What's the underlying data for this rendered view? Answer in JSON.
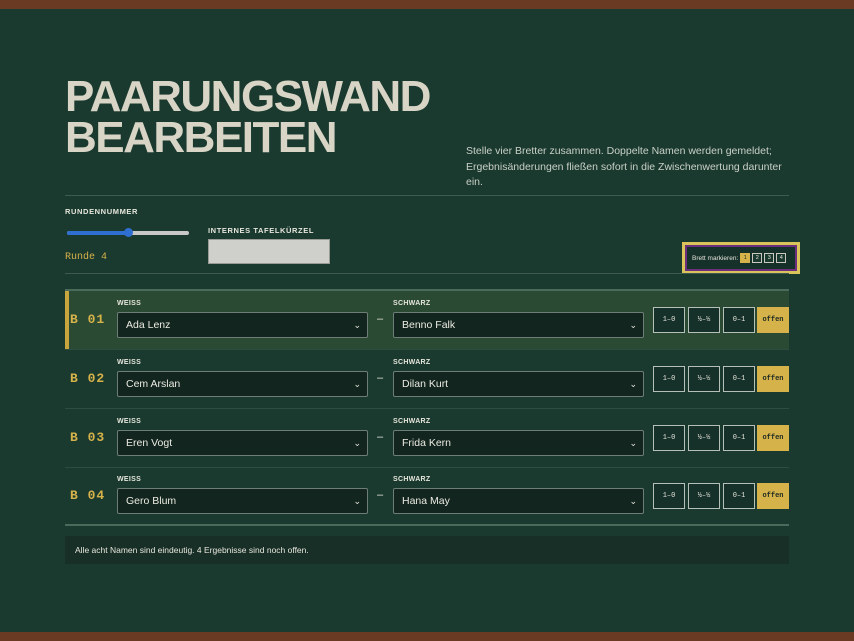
{
  "page": {
    "title_line1": "PAARUNGSWAND",
    "title_line2": "BEARBEITEN",
    "intro": "Stelle vier Bretter zusammen. Doppelte Namen werden gemeldet; Ergebnisänderungen fließen sofort in die Zwischenwertung darunter ein."
  },
  "controls": {
    "round_label": "RUNDENNUMMER",
    "round_value": 4,
    "round_min": 1,
    "round_max": 7,
    "round_text": "Runde 4",
    "kuerzel_label": "INTERNES TAFELKÜRZEL",
    "kuerzel_value": "",
    "marker_label": "Brett markieren:",
    "marker_buttons": [
      "1",
      "2",
      "3",
      "4"
    ],
    "marker_active": "1"
  },
  "boards": [
    {
      "label": "B 01",
      "white": "Ada Lenz",
      "black": "Benno Falk",
      "result": "offen"
    },
    {
      "label": "B 02",
      "white": "Cem Arslan",
      "black": "Dilan Kurt",
      "result": "offen"
    },
    {
      "label": "B 03",
      "white": "Eren Vogt",
      "black": "Frida Kern",
      "result": "offen"
    },
    {
      "label": "B 04",
      "white": "Gero Blum",
      "black": "Hana May",
      "result": "offen"
    }
  ],
  "labels": {
    "white": "WEISS",
    "black": "SCHWARZ",
    "dash": "–",
    "results": [
      "1–0",
      "½–½",
      "0–1",
      "offen"
    ]
  },
  "status": "Alle acht Namen sind eindeutig. 4 Ergebnisse sind noch offen.",
  "colors": {
    "background": "#1b3a2f",
    "accent": "#d6b24a",
    "border_bar": "#6b3a22",
    "marker_outline": "#d9c35a",
    "marker_frame": "#6b2f7d"
  }
}
